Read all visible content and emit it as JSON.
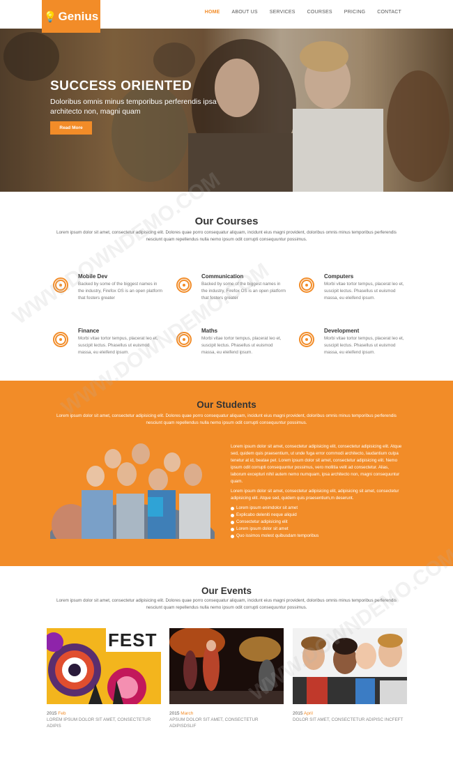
{
  "brand": {
    "name": "Genius"
  },
  "nav": [
    "HOME",
    "ABOUT US",
    "SERVICES",
    "COURSES",
    "PRICING",
    "CONTACT"
  ],
  "hero": {
    "title": "SUCCESS ORIENTED",
    "subtitle": "Doloribus omnis minus temporibus perferendis ipsa architecto non, magni quam",
    "button": "Read More"
  },
  "courses": {
    "title": "Our Courses",
    "desc": "Lorem ipsum dolor sit amet, consectetur adipisicing elit. Dolores quae porro consequatur aliquam, incidunt eius magni provident, doloribus omnis minus temporibus perferendis nesciunt quam repellendus nulla nemo ipsum odit corrupti consequuntur possimus.",
    "items": [
      {
        "title": "Mobile Dev",
        "text": "Backed by some of the biggest names in the industry, Firefox OS is an open platform that fosters greater"
      },
      {
        "title": "Communication",
        "text": "Backed by some of the biggest names in the industry, Firefox OS is an open platform that fosters greater"
      },
      {
        "title": "Computers",
        "text": "Morbi vitae tortor tempus, placerat leo et, suscipit lectus. Phasellus ut euismod massa, eu eleifend ipsum."
      },
      {
        "title": "Finance",
        "text": "Morbi vitae tortor tempus, placerat leo et, suscipit lectus. Phasellus ut euismod massa, eu eleifend ipsum."
      },
      {
        "title": "Maths",
        "text": "Morbi vitae tortor tempus, placerat leo et, suscipit lectus. Phasellus ut euismod massa, eu eleifend ipsum."
      },
      {
        "title": "Development",
        "text": "Morbi vitae tortor tempus, placerat leo et, suscipit lectus. Phasellus ut euismod massa, eu eleifend ipsum."
      }
    ]
  },
  "students": {
    "title": "Our Students",
    "desc": "Lorem ipsum dolor sit amet, consectetur adipisicing elit. Dolores quae porro consequatur aliquam, incidunt eius magni provident, doloribus omnis minus temporibus perferendis nesciunt quam repellendus nulla nemo ipsum odit corrupti consequuntur possimus.",
    "para1": "Lorem ipsum dolor sit amet, consectetur adipisicing elit, consectetur adipisicing elit. Atque sed, quidem quis praesentium, ut unde fuga error commodi architecto, laudantium culpa tenetur at id, beatae pet. Lorem ipsum dolor sit amet, consectetur adipisicing elit. Nemo ipsum odit corrupti consequuntur possimus, vero mollitia velit ad consectetur. Alias, laborum excepturi nihil autem nemo numquam, ipsa architecto non, magni consequuntur quam.",
    "para2": "Lorem ipsum dolor sit amet, consectetur adipisicing elit, adipisicing sit amet, consectetur adipisicing elit. Atque sed, quidem quis praesentium,m deserunt.",
    "list": [
      "Lorem ipsum enimdolor sit amet",
      "Explicabo deleniti neque aliquid",
      "Consectetur adipisicing elit",
      "Lorem ipsum dolor sit amet",
      "Quo issimos molest quibusdam temporibus"
    ]
  },
  "events": {
    "title": "Our Events",
    "desc": "Lorem ipsum dolor sit amet, consectetur adipisicing elit. Dolores quae porro consequatur aliquam, incidunt eius magni provident, doloribus omnis minus temporibus perferendis nesciunt quam repellendus nulla nemo ipsum odit corrupti consequuntur possimus.",
    "items": [
      {
        "year": "2015",
        "month": "Feb",
        "caption": "LOREM IPSUM DOLOR SIT AMET, CONSECTETUR ADIPIS",
        "poster": "FEST"
      },
      {
        "year": "2015",
        "month": "March",
        "caption": "APSUM DOLOR SIT AMET, CONSECTETUR ADIPISDSLIF"
      },
      {
        "year": "2015",
        "month": "April",
        "caption": "DOLOR SIT AMET, CONSECTETUR ADIPISC INCFEFT"
      }
    ]
  },
  "watermark": "WWW.DOWNDEMO.COM",
  "colors": {
    "accent": "#f28c28"
  }
}
